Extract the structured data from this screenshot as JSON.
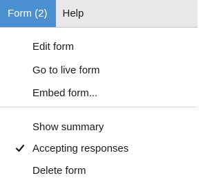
{
  "menubar": {
    "items": [
      {
        "label": "Form (2)",
        "active": true
      },
      {
        "label": "Help",
        "active": false
      }
    ]
  },
  "dropdown": {
    "group1": [
      {
        "label": "Edit form"
      },
      {
        "label": "Go to live form"
      },
      {
        "label": "Embed form..."
      }
    ],
    "group2": [
      {
        "label": "Show summary",
        "checked": false
      },
      {
        "label": "Accepting responses",
        "checked": true,
        "icon": "checkmark-icon"
      },
      {
        "label": "Delete form",
        "checked": false
      }
    ]
  },
  "colors": {
    "active_menu_bg": "#4a90d0",
    "menubar_bg": "#e8e8e8",
    "text": "#1a1a1a"
  }
}
